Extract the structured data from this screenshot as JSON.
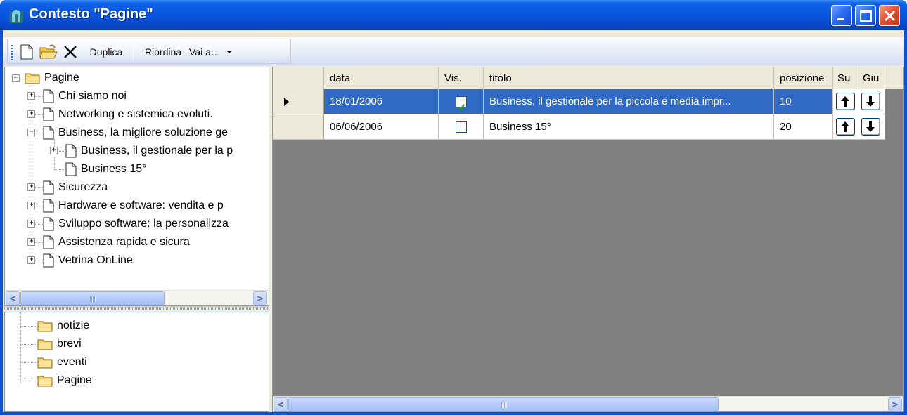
{
  "window": {
    "title": "Contesto \"Pagine\"",
    "title_color": "#ffffff",
    "titlebar_color": "#0a55de",
    "buttons": [
      "minimize",
      "maximize",
      "close"
    ]
  },
  "toolbar": {
    "new_icon": "new-document-icon",
    "open_icon": "open-folder-icon",
    "delete_icon": "delete-x-icon",
    "duplicate_label": "Duplica",
    "reorder_label": "Riordina",
    "goto_label": "Vai a…"
  },
  "tree": {
    "root_label": "Pagine",
    "nodes": [
      {
        "label": "Chi siamo noi",
        "expander": "+"
      },
      {
        "label": "Networking e sistemica evoluti.",
        "expander": "+"
      },
      {
        "label": "Business, la migliore soluzione ge",
        "expander": "−"
      },
      {
        "label": "Business, il gestionale per la p",
        "expander": "+"
      },
      {
        "label": "Business 15°",
        "expander": ""
      },
      {
        "label": "Sicurezza",
        "expander": "+"
      },
      {
        "label": "Hardware e software: vendita e p",
        "expander": "+"
      },
      {
        "label": "Sviluppo software: la personalizza",
        "expander": "+"
      },
      {
        "label": "Assistenza rapida e sicura",
        "expander": "+"
      },
      {
        "label": "Vetrina OnLine",
        "expander": "+"
      }
    ]
  },
  "contexts": [
    "notizie",
    "brevi",
    "eventi",
    "Pagine"
  ],
  "grid": {
    "columns": [
      "data",
      "Vis.",
      "titolo",
      "posizione",
      "Su",
      "Giu"
    ],
    "rows": [
      {
        "data": "18/01/2006",
        "vis": true,
        "titolo": "Business, il gestionale per la piccola e media impr...",
        "posizione": "10"
      },
      {
        "data": "06/06/2006",
        "vis": false,
        "titolo": "Business 15°",
        "posizione": "20"
      }
    ],
    "selected_color": "#316ac5",
    "empty_area_color": "#808080"
  }
}
